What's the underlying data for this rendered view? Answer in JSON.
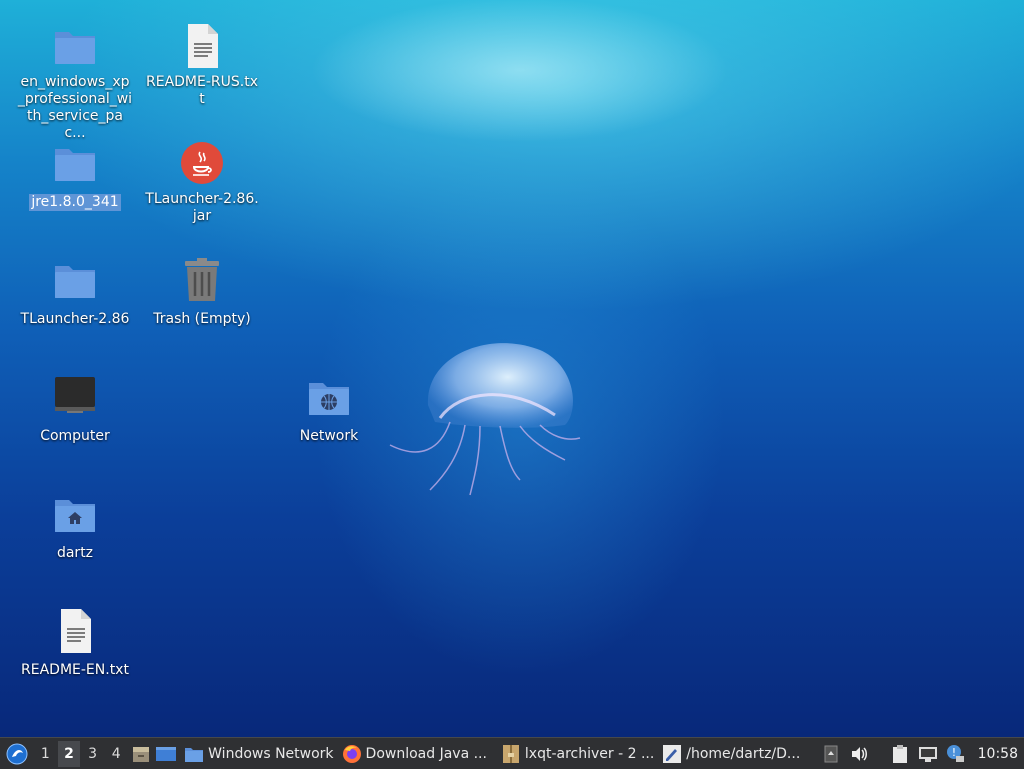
{
  "desktop": {
    "icons": [
      {
        "label": "en_windows_xp_professional_with_service_pac...",
        "type": "folder"
      },
      {
        "label": "README-RUS.txt",
        "type": "text-file"
      },
      {
        "label": "jre1.8.0_341",
        "type": "folder"
      },
      {
        "label": "TLauncher-2.86.jar",
        "type": "java-jar"
      },
      {
        "label": "TLauncher-2.86",
        "type": "folder"
      },
      {
        "label": "Trash (Empty)",
        "type": "trash"
      },
      {
        "label": "Computer",
        "type": "computer"
      },
      {
        "label": "Network",
        "type": "network-folder"
      },
      {
        "label": "dartz",
        "type": "home-folder"
      },
      {
        "label": "README-EN.txt",
        "type": "text-file"
      }
    ],
    "selected_icon": "jre1.8.0_341"
  },
  "taskbar": {
    "workspaces": [
      "1",
      "2",
      "3",
      "4"
    ],
    "active_workspace": "2",
    "tasks": [
      {
        "label": "Windows Network",
        "icon": "folder-icon"
      },
      {
        "label": "Download Java ...",
        "icon": "firefox-icon"
      },
      {
        "label": "lxqt-archiver - 2 ...",
        "icon": "archive-icon"
      },
      {
        "label": "/home/dartz/D...",
        "icon": "text-editor-icon"
      }
    ],
    "clock": "10:58"
  },
  "colors": {
    "selection": "#5f95d6",
    "folder": "#5b8fd9",
    "taskbar": "#2f3033",
    "java": "#e04a3a"
  }
}
